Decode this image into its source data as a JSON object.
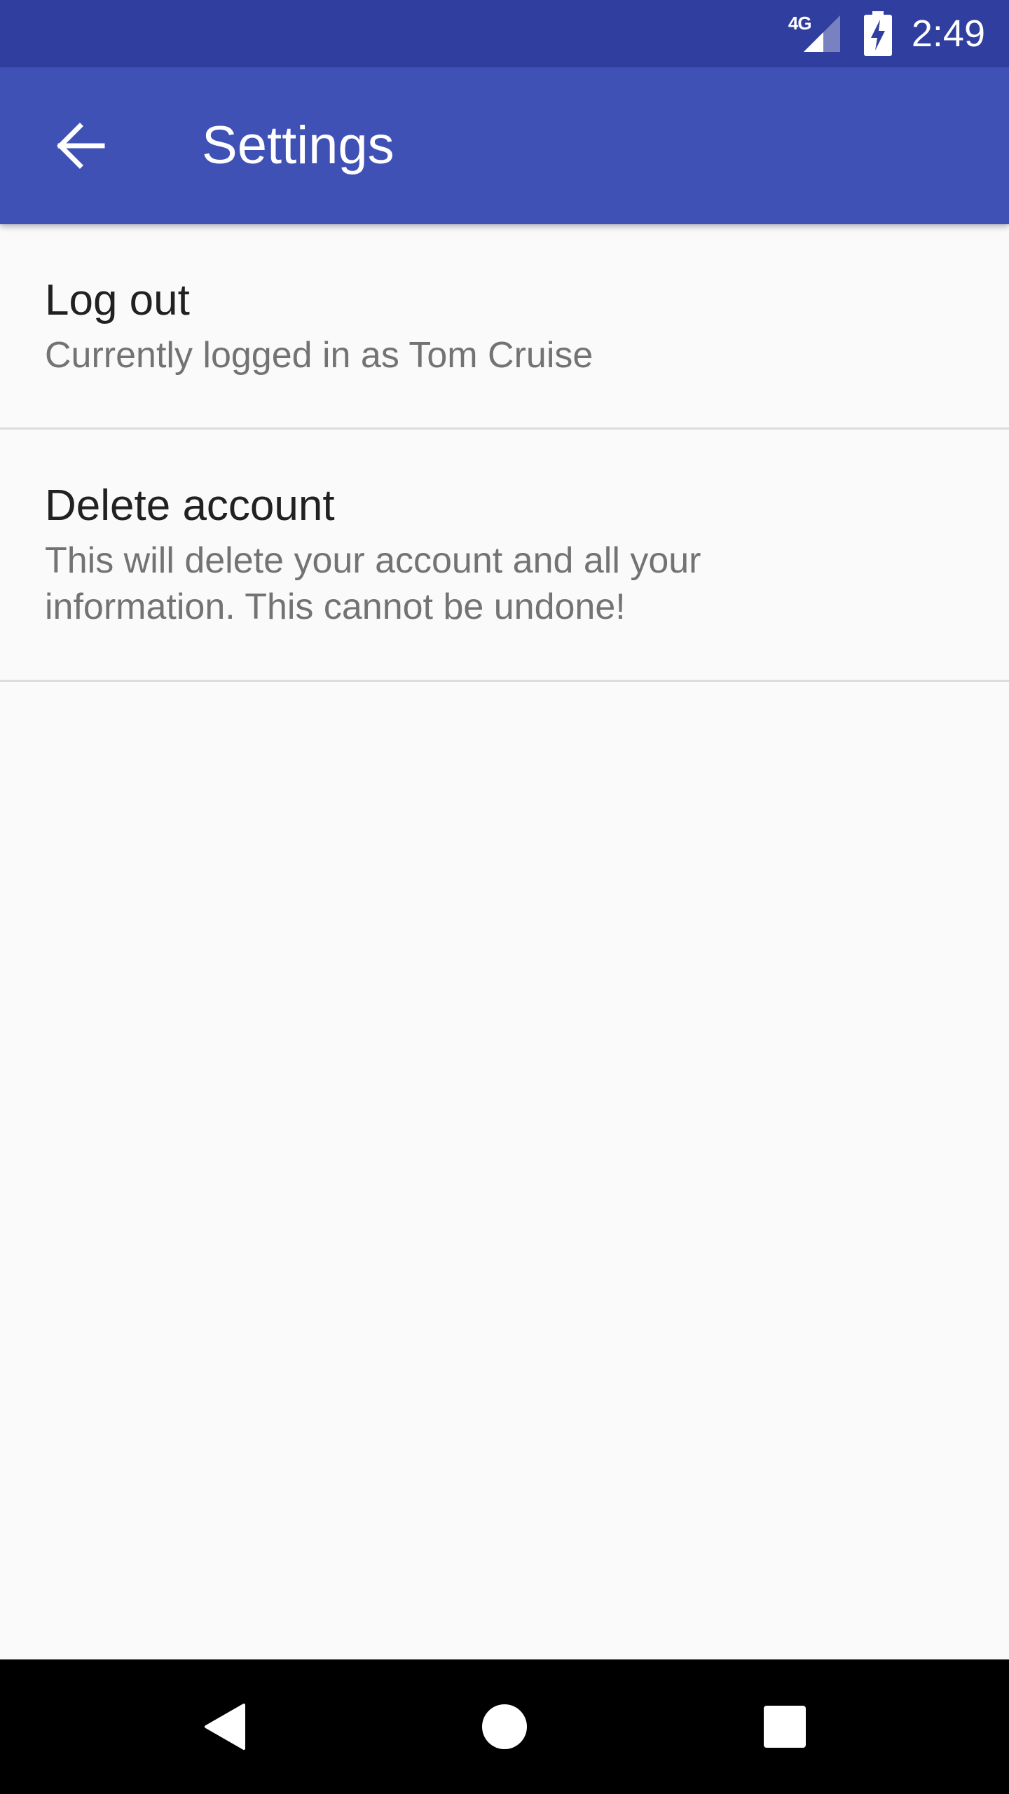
{
  "status_bar": {
    "network_label": "4G",
    "time": "2:49",
    "icons": [
      "signal-icon",
      "battery-charging-icon"
    ]
  },
  "app_bar": {
    "title": "Settings",
    "back_icon": "arrow-back-icon"
  },
  "preferences": [
    {
      "title": "Log out",
      "summary": "Currently logged in as Tom Cruise"
    },
    {
      "title": "Delete account",
      "summary": "This will delete your account and all your information. This cannot be undone!"
    }
  ],
  "navigation_bar": {
    "icons": [
      "nav-back-icon",
      "nav-home-icon",
      "nav-recents-icon"
    ]
  },
  "colors": {
    "status_bar": "#303f9f",
    "app_bar": "#3f51b5",
    "background": "#fafafa",
    "title_text": "#212121",
    "summary_text": "#737373",
    "divider": "#dcdcdc",
    "nav_bar": "#000000"
  }
}
